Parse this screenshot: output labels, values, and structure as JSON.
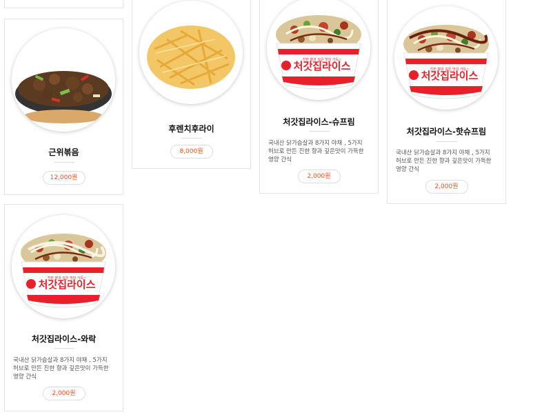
{
  "colors": {
    "price_text": "#ff4e1a",
    "card_border": "#e4e4e4",
    "bowl_red": "#e8202a"
  },
  "menu_items": [
    {
      "id": "geunwi",
      "title": "근위볶음",
      "description": "",
      "price": "12,000원",
      "image_icon": "stir-fried-gizzard-image"
    },
    {
      "id": "fries",
      "title": "후렌치후라이",
      "description": "",
      "price": "8,000원",
      "image_icon": "french-fries-image"
    },
    {
      "id": "supreme",
      "title": "처갓집라이스-슈프림",
      "description": "국내산 닭가슴살과 8가지 야채 , 5가지 허브로 만든 진한 향과 깊은맛이 가득한 영양 간식",
      "price": "2,000원",
      "image_icon": "rice-bowl-image"
    },
    {
      "id": "hot-supreme",
      "title": "처갓집라이스-핫슈프림",
      "description": "국내산 닭가슴살과 8가지 야채 , 5가지 허브로 만든 진한 향과 깊은맛이 가득한 영양 간식",
      "price": "2,000원",
      "image_icon": "rice-bowl-image"
    },
    {
      "id": "wa-rak",
      "title": "처갓집라이스-와락",
      "description": "국내산 닭가슴살과 8가지 야채 , 5가지 허브로 만든 진한 향과 깊은맛이 가득한 영양 간식",
      "price": "2,000원",
      "image_icon": "rice-bowl-image"
    }
  ],
  "bowl_logo_text": "처갓집라이스",
  "bowl_slogan_text": "진한 향과 깊은 맛이 가득~"
}
